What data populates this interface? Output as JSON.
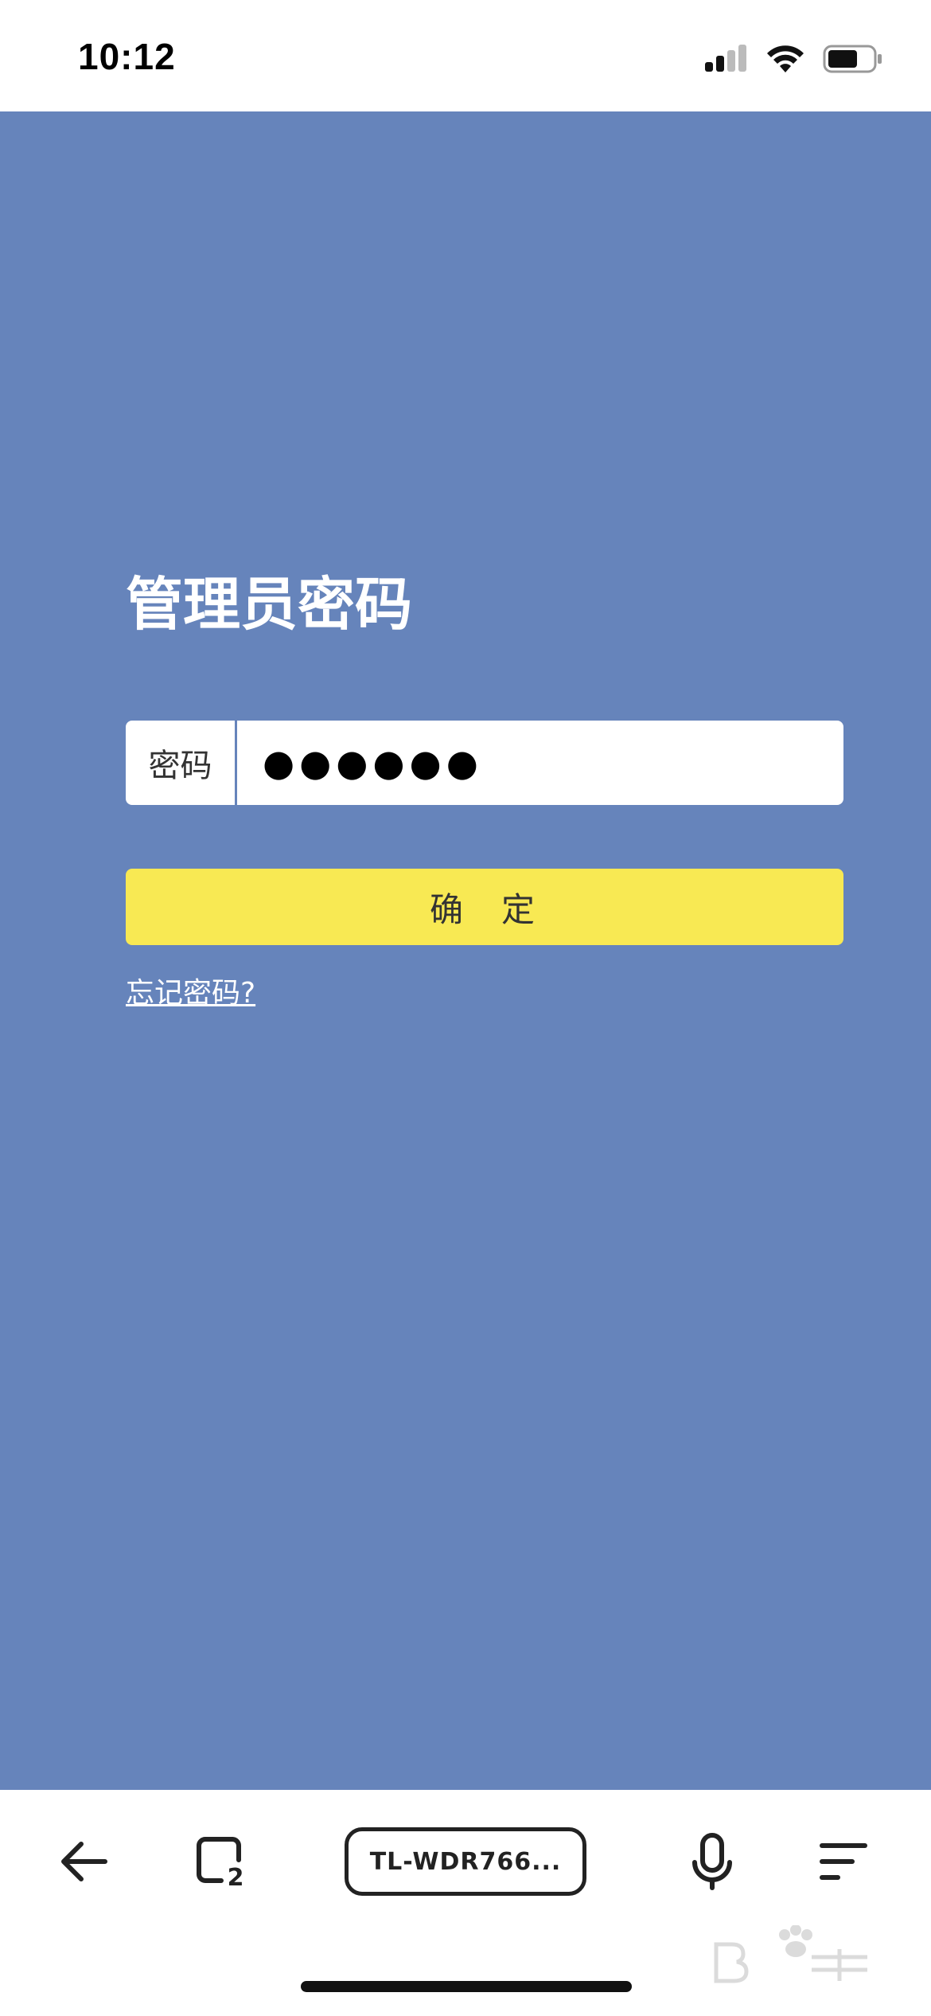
{
  "status_bar": {
    "time": "10:12",
    "icons": [
      "signal-icon",
      "wifi-icon",
      "battery-icon"
    ]
  },
  "login": {
    "title": "管理员密码",
    "password_label": "密码",
    "password_value": "●●●●●●",
    "confirm_label": "确定",
    "forgot_label": "忘记密码?"
  },
  "toolbar": {
    "url_label": "TL-WDR766...",
    "tab_count": "2",
    "icons": [
      "back-arrow-icon",
      "tabs-icon",
      "microphone-icon",
      "menu-icon"
    ]
  },
  "colors": {
    "background": "#6684bb",
    "button": "#f8e953",
    "text_light": "#ffffff"
  }
}
